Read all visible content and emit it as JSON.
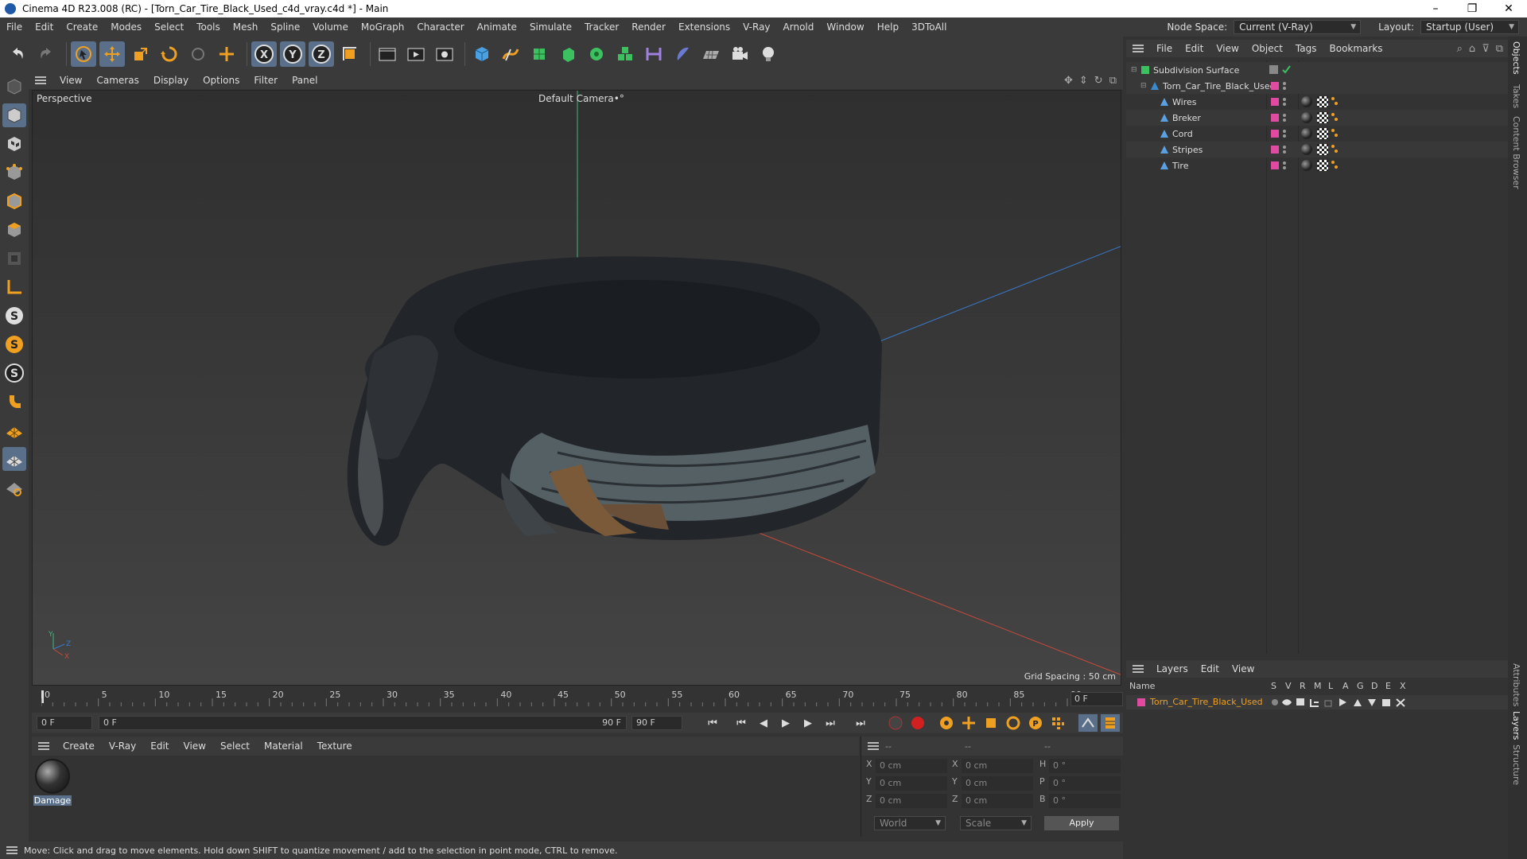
{
  "window": {
    "title": "Cinema 4D R23.008 (RC) - [Torn_Car_Tire_Black_Used_c4d_vray.c4d *] - Main",
    "controls": [
      "–",
      "❐",
      "✕"
    ]
  },
  "menubar": {
    "items": [
      "File",
      "Edit",
      "Create",
      "Modes",
      "Select",
      "Tools",
      "Mesh",
      "Spline",
      "Volume",
      "MoGraph",
      "Character",
      "Animate",
      "Simulate",
      "Tracker",
      "Render",
      "Extensions",
      "V-Ray",
      "Arnold",
      "Window",
      "Help",
      "3DToAll"
    ],
    "node_space_label": "Node Space:",
    "node_space_value": "Current (V-Ray)",
    "layout_label": "Layout:",
    "layout_value": "Startup (User)"
  },
  "toolbar": {
    "icons": [
      "undo-icon",
      "redo-icon",
      "select-icon",
      "move-icon",
      "scale-icon",
      "rotate-icon",
      "recent-tools-icon",
      "live-select-icon",
      "x-axis-icon",
      "y-axis-icon",
      "z-axis-icon",
      "coordinate-system-icon",
      "render-view-icon",
      "render-picture-viewer-icon",
      "render-settings-icon",
      "cube-icon",
      "pen-spline-icon",
      "subdivision-icon",
      "extrude-icon",
      "cloner-icon",
      "fracture-icon",
      "measure-icon",
      "deformer-icon",
      "floor-icon",
      "camera-icon",
      "light-icon"
    ],
    "axis_labels": [
      "X",
      "Y",
      "Z"
    ]
  },
  "left_toolbar": {
    "icons": [
      "make-editable-icon",
      "model-mode-icon",
      "texture-mode-icon",
      "points-mode-icon",
      "edges-mode-icon",
      "polygons-mode-icon",
      "uv-mode-icon",
      "axis-mode-icon",
      "snap-icon",
      "snap-vertex-icon",
      "snap-settings-icon",
      "magnet-icon",
      "workplane-icon",
      "grid-icon",
      "locked-workplane-icon"
    ]
  },
  "viewport": {
    "menu": [
      "View",
      "Cameras",
      "Display",
      "Options",
      "Filter",
      "Panel"
    ],
    "view_name": "Perspective",
    "camera": "Default Camera",
    "camera_suffix": "•°",
    "grid_spacing": "Grid Spacing : 50 cm",
    "axis_gizmo": {
      "y": "Y",
      "z": "Z",
      "x": "X"
    }
  },
  "timeline": {
    "ticks": [
      "0",
      "5",
      "10",
      "15",
      "20",
      "25",
      "30",
      "35",
      "40",
      "45",
      "50",
      "55",
      "60",
      "65",
      "70",
      "75",
      "80",
      "85",
      "90"
    ],
    "frame_end_field": "0 F",
    "current_frame": "0 F",
    "range_start": "0 F",
    "range_end": "90 F",
    "max_frame": "90 F"
  },
  "material_manager": {
    "menu": [
      "Create",
      "V-Ray",
      "Edit",
      "View",
      "Select",
      "Material",
      "Texture"
    ],
    "materials": [
      {
        "name": "Damage"
      }
    ]
  },
  "coordinates": {
    "header": [
      "--",
      "--",
      "--"
    ],
    "rows": [
      {
        "axis": "X",
        "pos": "0 cm",
        "axis2": "X",
        "size": "0 cm",
        "axis3": "H",
        "rot": "0 °"
      },
      {
        "axis": "Y",
        "pos": "0 cm",
        "axis2": "Y",
        "size": "0 cm",
        "axis3": "P",
        "rot": "0 °"
      },
      {
        "axis": "Z",
        "pos": "0 cm",
        "axis2": "Z",
        "size": "0 cm",
        "axis3": "B",
        "rot": "0 °"
      }
    ],
    "mode_dropdown": "World",
    "type_dropdown": "Scale",
    "apply_label": "Apply"
  },
  "status": {
    "text": "Move: Click and drag to move elements. Hold down SHIFT to quantize movement / add to the selection in point mode, CTRL to remove."
  },
  "object_manager": {
    "menu": [
      "File",
      "Edit",
      "View",
      "Object",
      "Tags",
      "Bookmarks"
    ],
    "objects": [
      {
        "name": "Subdivision Surface",
        "level": 0,
        "icon": "subdivision-icon"
      },
      {
        "name": "Torn_Car_Tire_Black_Used",
        "level": 1,
        "icon": "null-icon"
      },
      {
        "name": "Wires",
        "level": 2,
        "icon": "polygon-object-icon"
      },
      {
        "name": "Breker",
        "level": 2,
        "icon": "polygon-object-icon"
      },
      {
        "name": "Cord",
        "level": 2,
        "icon": "polygon-object-icon"
      },
      {
        "name": "Stripes",
        "level": 2,
        "icon": "polygon-object-icon"
      },
      {
        "name": "Tire",
        "level": 2,
        "icon": "polygon-object-icon"
      }
    ]
  },
  "layers": {
    "menu": [
      "Layers",
      "Edit",
      "View"
    ],
    "columns": [
      "Name",
      "S",
      "V",
      "R",
      "M",
      "L",
      "A",
      "G",
      "D",
      "E",
      "X"
    ],
    "rows": [
      {
        "name": "Torn_Car_Tire_Black_Used",
        "color": "#e04aa0"
      }
    ]
  },
  "side_tabs": [
    "Objects",
    "Takes",
    "Content Browser",
    "Attributes",
    "Layers",
    "Structure"
  ],
  "colors": {
    "accent": "#5a6f8a",
    "layer_color": "#e04aa0",
    "highlight_text": "#f0a020"
  }
}
